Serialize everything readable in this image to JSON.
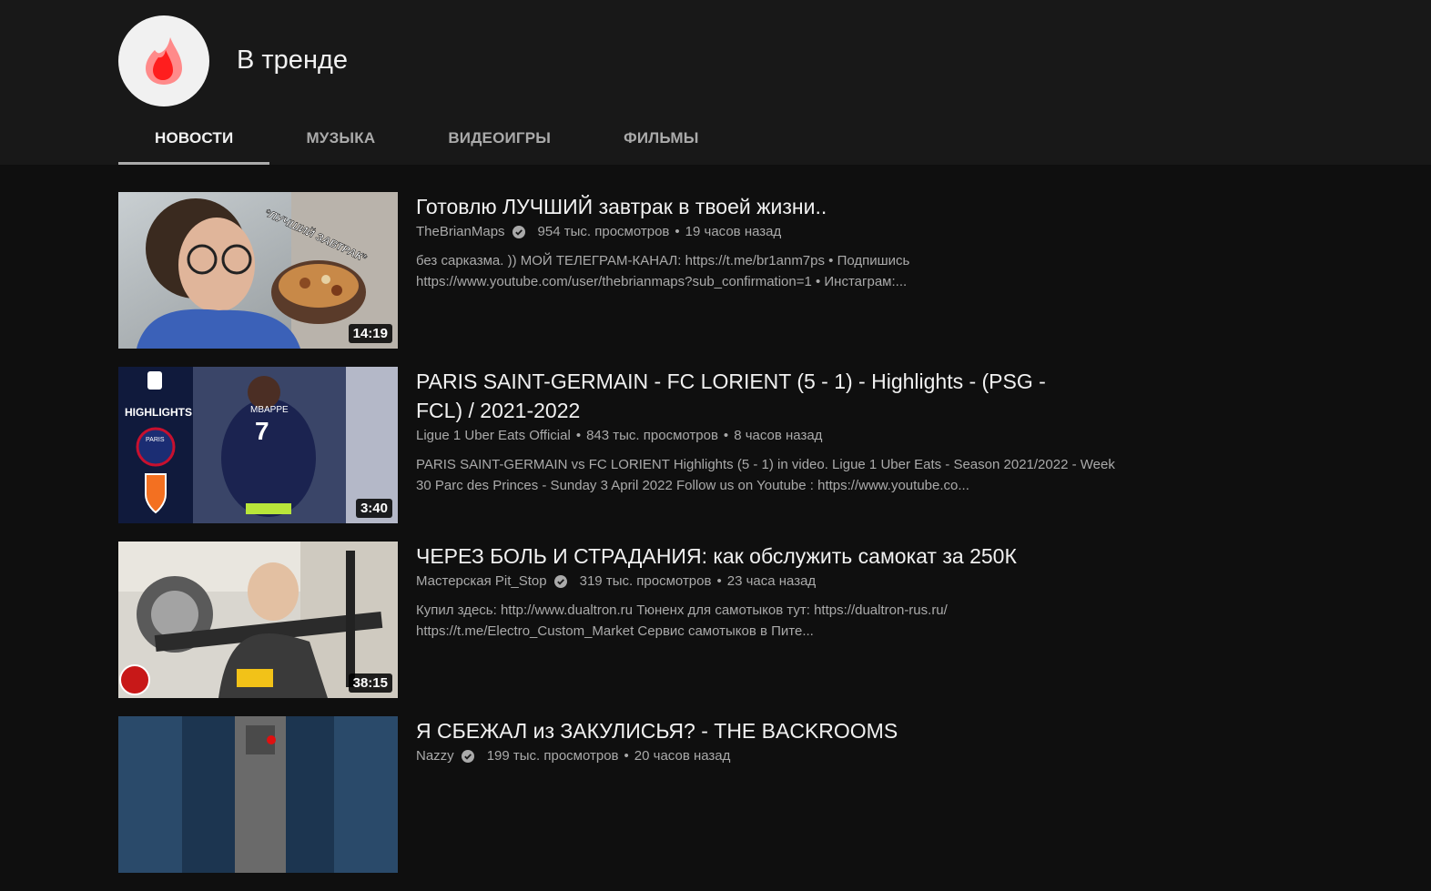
{
  "page": {
    "title": "В тренде"
  },
  "tabs": [
    {
      "label": "НОВОСТИ",
      "active": true
    },
    {
      "label": "МУЗЫКА",
      "active": false
    },
    {
      "label": "ВИДЕОИГРЫ",
      "active": false
    },
    {
      "label": "ФИЛЬМЫ",
      "active": false
    }
  ],
  "icons": {
    "channel_avatar": "trending-flame-icon",
    "verified": "verified-check-icon"
  },
  "colors": {
    "accent": "#ff4e45",
    "background": "#0f0f0f",
    "header": "#181818"
  },
  "videos": [
    {
      "title": "Готовлю ЛУЧШИЙ завтрак в твоей жизни..",
      "channel": "TheBrianMaps",
      "verified": true,
      "views": "954 тыс. просмотров",
      "age": "19 часов назад",
      "desc1": "без сарказма. )) МОЙ ТЕЛЕГРАМ-КАНАЛ: https://t.me/br1anm7ps • Подпишись",
      "desc2": "https://www.youtube.com/user/thebrianmaps?sub_confirmation=1 • Инстаграм:...",
      "duration": "14:19",
      "thumb_text": "*ЛУЧШИЙ ЗАВТРАК*"
    },
    {
      "title": "PARIS SAINT-GERMAIN - FC LORIENT (5 - 1) - Highlights - (PSG - FCL) / 2021-2022",
      "channel": "Ligue 1 Uber Eats Official",
      "verified": false,
      "views": "843 тыс. просмотров",
      "age": "8 часов назад",
      "desc1": "PARIS SAINT-GERMAIN vs FC LORIENT Highlights (5 - 1) in video. Ligue 1 Uber Eats - Season 2021/2022 - Week",
      "desc2": "30 Parc des Princes - Sunday 3 April 2022 Follow us on Youtube : https://www.youtube.co...",
      "duration": "3:40",
      "thumb_text": "HIGHLIGHTS"
    },
    {
      "title": "ЧЕРЕЗ БОЛЬ И СТРАДАНИЯ: как обслужить самокат за 250К",
      "channel": "Мастерская Pit_Stop",
      "verified": true,
      "views": "319 тыс. просмотров",
      "age": "23 часа назад",
      "desc1": "Купил здесь: http://www.dualtron.ru Тюненх для самотыков тут: https://dualtron-rus.ru/",
      "desc2": "https://t.me/Electro_Custom_Market Сервис самотыков в Пите...",
      "duration": "38:15",
      "thumb_text": ""
    },
    {
      "title": "Я СБЕЖАЛ из ЗАКУЛИСЬЯ? - THE BACKROOMS",
      "channel": "Nazzy",
      "verified": true,
      "views": "199 тыс. просмотров",
      "age": "20 часов назад",
      "desc1": "",
      "desc2": "",
      "duration": "",
      "thumb_text": ""
    }
  ]
}
